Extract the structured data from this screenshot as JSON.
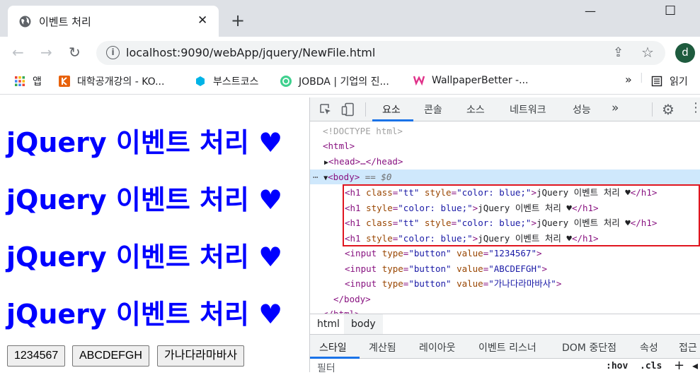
{
  "browser": {
    "tab_title": "이벤트 처리",
    "tab_close": "✕",
    "new_tab": "+",
    "win_min": "—",
    "win_max": "☐",
    "url": "localhost:9090/webApp/jquery/NewFile.html",
    "profile_initial": "d",
    "bookmarks": [
      {
        "label": "앱"
      },
      {
        "label": "대학공개강의 - KO..."
      },
      {
        "label": "부스트코스"
      },
      {
        "label": "JOBDA | 기업의 진..."
      },
      {
        "label": "WallpaperBetter -..."
      }
    ],
    "bookmarks_overflow": "»",
    "reading_list": "읽기"
  },
  "page": {
    "headings": [
      "jQuery 이벤트 처리 ♥",
      "jQuery 이벤트 처리 ♥",
      "jQuery 이벤트 처리 ♥",
      "jQuery 이벤트 처리 ♥"
    ],
    "heading_color": "#0000ff",
    "buttons": [
      "1234567",
      "ABCDEFGH",
      "가나다라마바사"
    ]
  },
  "devtools": {
    "tabs": [
      "요소",
      "콘솔",
      "소스",
      "네트워크",
      "성능"
    ],
    "tabs_more": "»",
    "dom": {
      "doctype": "<!DOCTYPE html>",
      "html_open": "<html>",
      "head": "<head>…</head>",
      "body_open": "<body>",
      "body_eq": " == $0",
      "h1_lines": [
        {
          "pre": "<h1 ",
          "a1": "class",
          "v1": "\"tt\"",
          "a2": "style",
          "v2": "\"color: blue;\"",
          "text": "jQuery 이벤트 처리 ♥",
          "close": "</h1>"
        },
        {
          "pre": "<h1 ",
          "a1": "",
          "v1": "",
          "a2": "style",
          "v2": "\"color: blue;\"",
          "text": "jQuery 이벤트 처리 ♥",
          "close": "</h1>"
        },
        {
          "pre": "<h1 ",
          "a1": "class",
          "v1": "\"tt\"",
          "a2": "style",
          "v2": "\"color: blue;\"",
          "text": "jQuery 이벤트 처리 ♥",
          "close": "</h1>"
        },
        {
          "pre": "<h1 ",
          "a1": "",
          "v1": "",
          "a2": "style",
          "v2": "\"color: blue;\"",
          "text": "jQuery 이벤트 처리 ♥",
          "close": "</h1>"
        }
      ],
      "inputs": [
        {
          "type": "\"button\"",
          "value": "\"1234567\""
        },
        {
          "type": "\"button\"",
          "value": "\"ABCDEFGH\""
        },
        {
          "type": "\"button\"",
          "value": "\"가나다라마바사\""
        }
      ],
      "body_close": "</body>",
      "html_close": "</html>"
    },
    "breadcrumbs": [
      "html",
      "body"
    ],
    "lower_tabs": [
      "스타일",
      "계산됨",
      "레이아웃",
      "이벤트 리스너",
      "DOM 중단점",
      "속성",
      "접근"
    ],
    "filter_placeholder": "필터",
    "hov": ":hov",
    "cls": ".cls",
    "highlight_color": "#e0151f"
  }
}
